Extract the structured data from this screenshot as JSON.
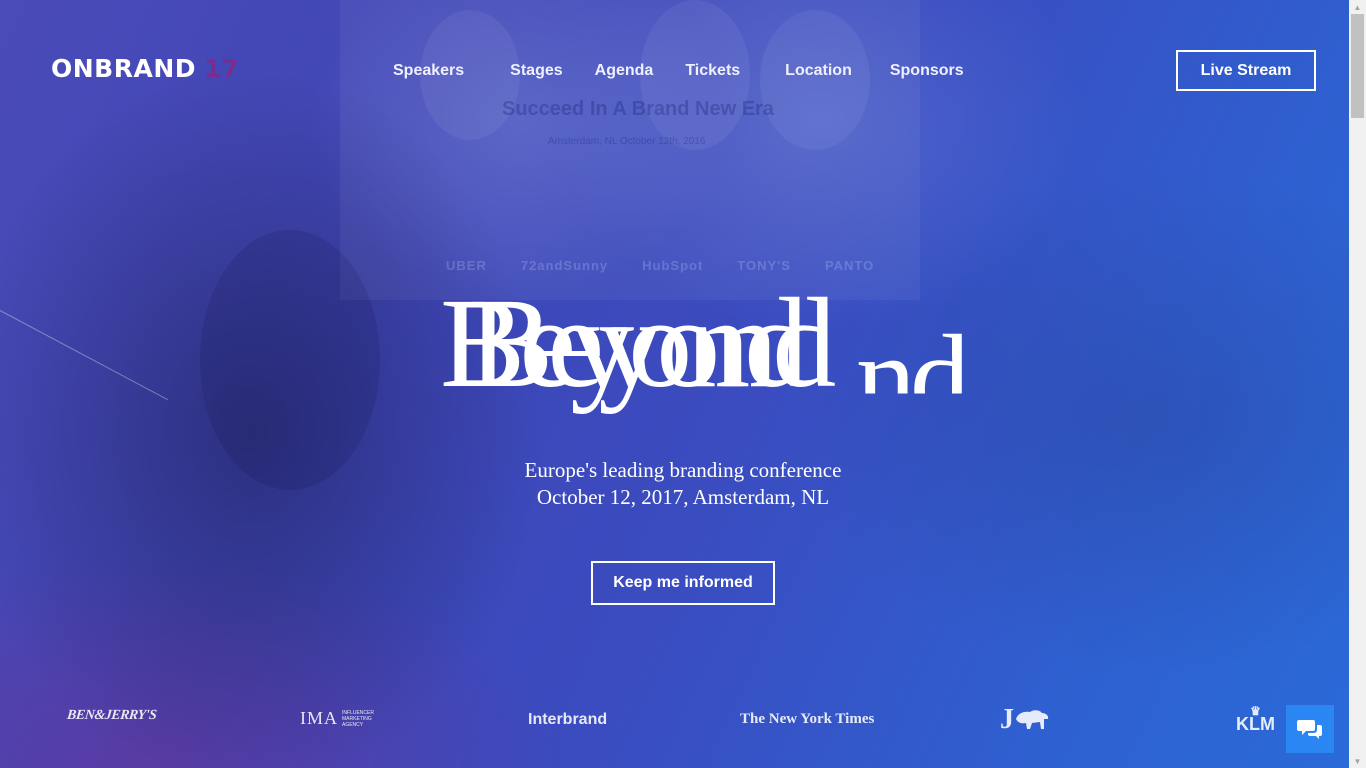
{
  "header": {
    "logo_main": "ONBRAND",
    "logo_year": "17",
    "nav": [
      "Speakers",
      "Stages",
      "Agenda",
      "Tickets",
      "Location",
      "Sponsors"
    ],
    "live_button": "Live Stream"
  },
  "hero": {
    "title_words": [
      "Beyond",
      "Beyond",
      "nd"
    ],
    "tagline_line1": "Europe's leading branding conference",
    "tagline_line2": "October 12, 2017, Amsterdam, NL",
    "cta": "Keep me informed"
  },
  "background": {
    "screen_heading": "Succeed In A Brand New Era",
    "screen_sub": "Amsterdam, NL   October 12th, 2016",
    "sponsor_marks": [
      "UBER",
      "72andSunny",
      "HubSpot",
      "TONY'S",
      "PANTO"
    ]
  },
  "brands": [
    "BEN&JERRY'S",
    "IMA",
    "Interbrand",
    "The New York Times",
    "J",
    "KLM"
  ],
  "brand_sub": "INFLUENCER MARKETING AGENCY",
  "chat": {
    "icon": "chat-bubbles-icon",
    "color": "#2a86f3"
  },
  "colors": {
    "logo_accent": "#7b2c8f",
    "bg_start": "#4a4bb8",
    "bg_end": "#2a6ad8"
  }
}
